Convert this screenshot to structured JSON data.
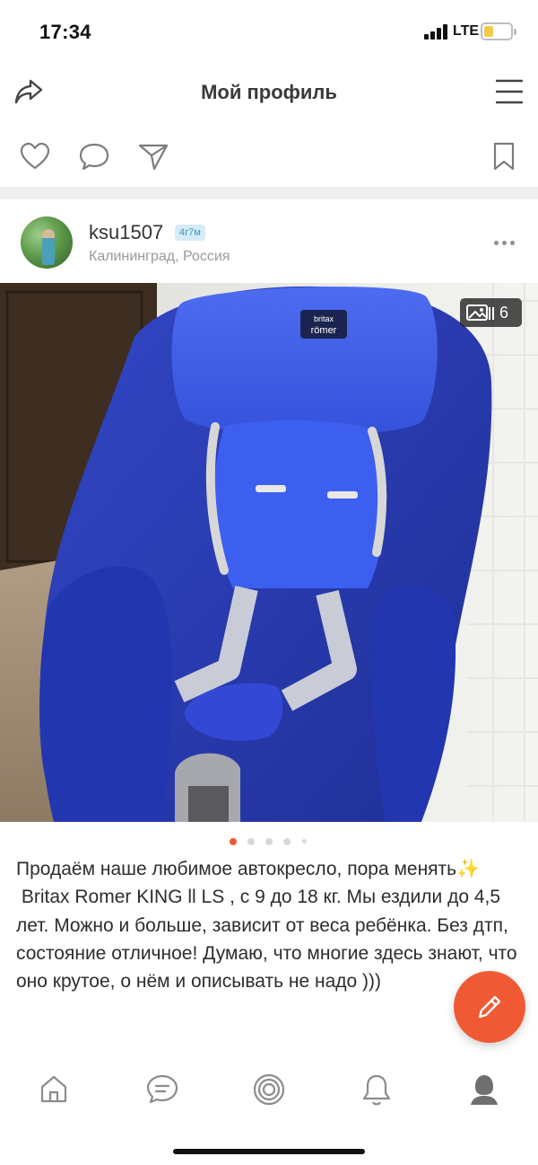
{
  "status_bar": {
    "time": "17:34",
    "network": "LTE",
    "battery_level": 0.3
  },
  "header": {
    "title": "Мой профиль",
    "share_icon": "share-icon",
    "menu_icon": "hamburger-menu-icon"
  },
  "actions": {
    "like_icon": "heart-icon",
    "comment_icon": "comment-icon",
    "send_icon": "send-icon",
    "bookmark_icon": "bookmark-icon"
  },
  "author": {
    "username": "ksu1507",
    "age_badge": "4г7м",
    "location": "Калининград, Россия"
  },
  "photo": {
    "count": "6",
    "active_index": 0,
    "dots_total": 5
  },
  "description": {
    "line1": "Продаём наше любимое автокресло, пора менять",
    "sparkle": "✨",
    "body": "\n Britax Romer KING ll LS , с 9 до 18 кг. Мы ездили до 4,5 лет. Можно и больше, зависит от веса ребёнка. Без дтп, состояние отличное! Думаю, что многие здесь знают, что оно крутое, о нём и описывать не надо )))"
  },
  "seat_brand": {
    "line1": "britax",
    "line2": "römer"
  },
  "colors": {
    "accent": "#ef5a34",
    "badge_bg": "#d6ecf7",
    "badge_text": "#3a97c4",
    "seat_blue": "#2b3fb8"
  },
  "bottom_nav": [
    "home-icon",
    "chat-icon",
    "target-icon",
    "bell-icon",
    "profile-icon"
  ]
}
